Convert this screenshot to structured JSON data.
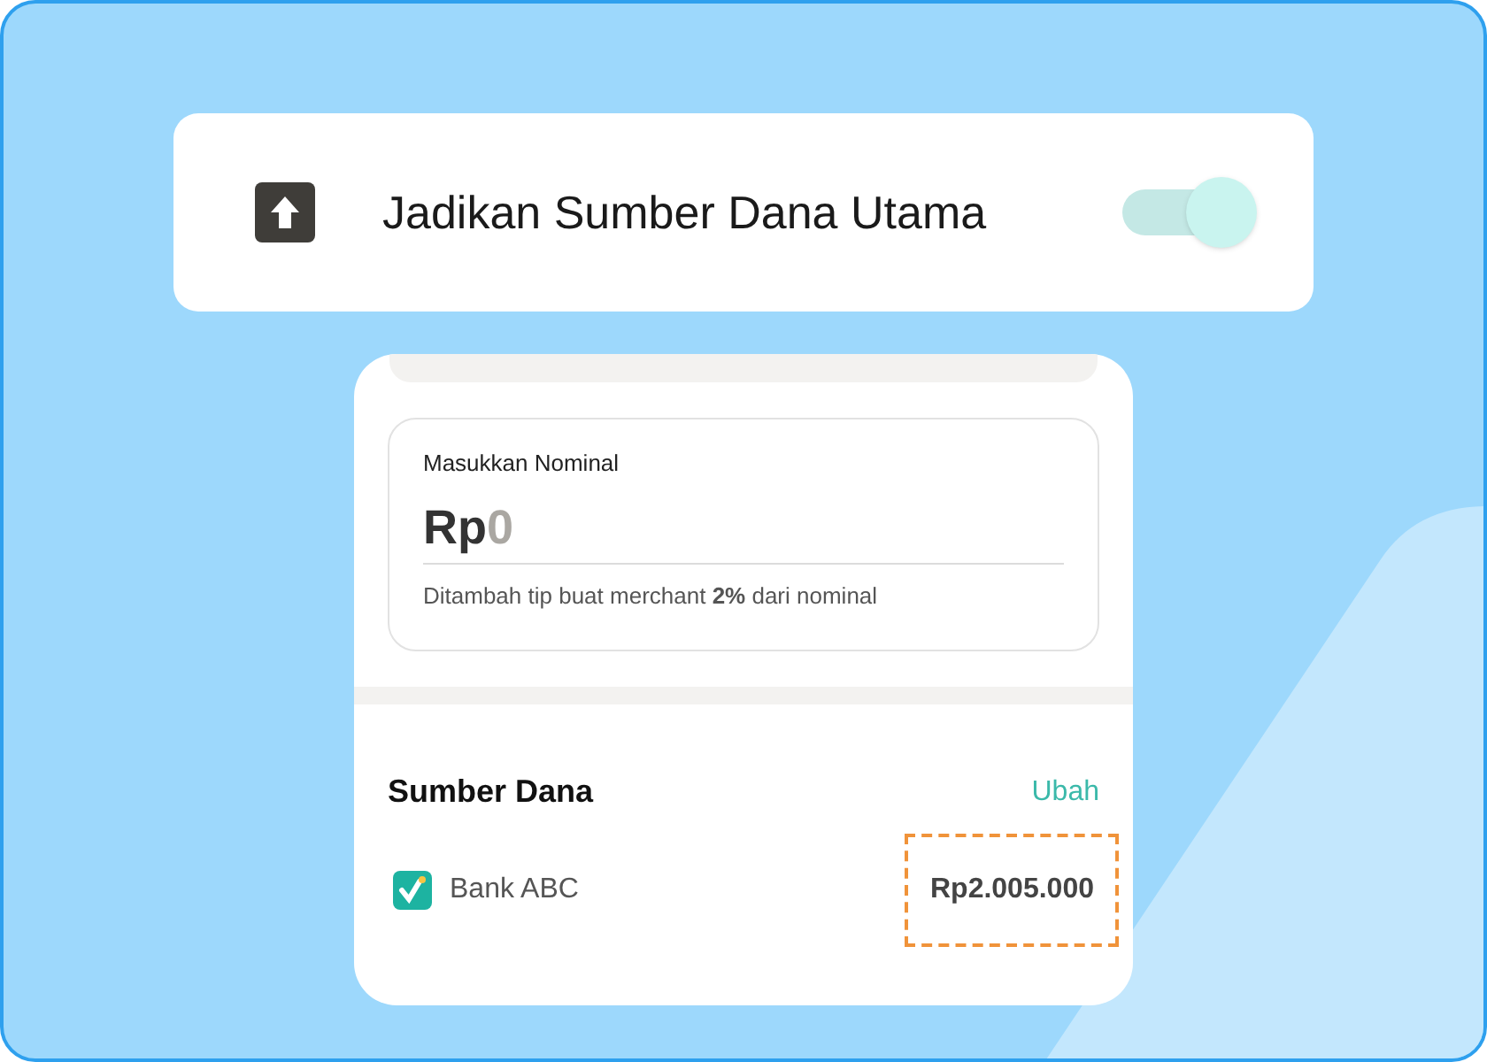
{
  "primary_setting": {
    "label": "Jadikan Sumber Dana Utama",
    "on": true
  },
  "nominal": {
    "label": "Masukkan Nominal",
    "prefix": "Rp",
    "placeholder": "0",
    "note": "Ditambah tip buat merchant **2%** dari nominal"
  },
  "source": {
    "title": "Sumber Dana",
    "action": "Ubah",
    "account": "Bank ABC",
    "balance": "Rp2.005.000",
    "highlighted": true
  }
}
